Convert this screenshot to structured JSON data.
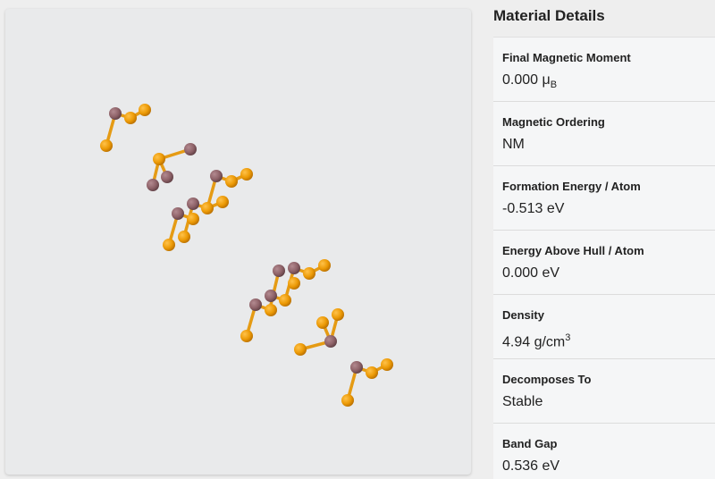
{
  "viewer": {
    "atoms": {
      "colors": {
        "gold": "#ec9a06",
        "mauve": "#8e6268"
      }
    }
  },
  "details": {
    "title": "Material Details",
    "items": [
      {
        "label": "Final Magnetic Moment",
        "value": "0.000 ",
        "unit_base": "μ",
        "unit_sub": "B"
      },
      {
        "label": "Magnetic Ordering",
        "value": "NM"
      },
      {
        "label": "Formation Energy / Atom",
        "value": "-0.513 eV"
      },
      {
        "label": "Energy Above Hull / Atom",
        "value": "0.000 eV"
      },
      {
        "label": "Density",
        "value": "4.94 g/cm",
        "sup": "3"
      },
      {
        "label": "Decomposes To",
        "value": "Stable"
      },
      {
        "label": "Band Gap",
        "value": "0.536 eV"
      }
    ]
  }
}
